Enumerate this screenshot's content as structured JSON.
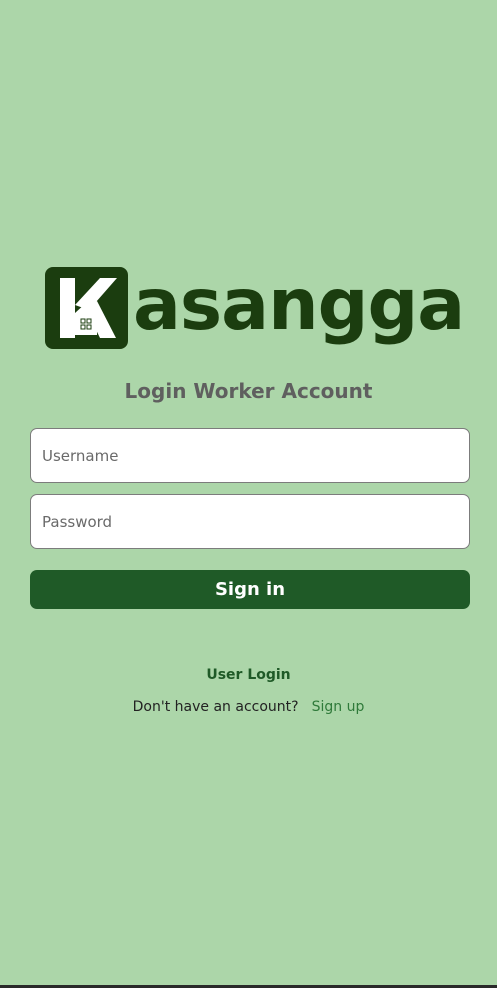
{
  "brand": {
    "logo_letter": "K",
    "logo_rest": "asangga",
    "color": "#1b3d0f"
  },
  "page": {
    "title": "Login Worker Account",
    "background": "#acd6a9"
  },
  "form": {
    "username_placeholder": "Username",
    "password_placeholder": "Password",
    "signin_label": "Sign in",
    "button_color": "#1f5a27"
  },
  "links": {
    "user_login": "User Login",
    "signup_prompt": "Don't have an account?",
    "signup_label": "Sign up"
  }
}
